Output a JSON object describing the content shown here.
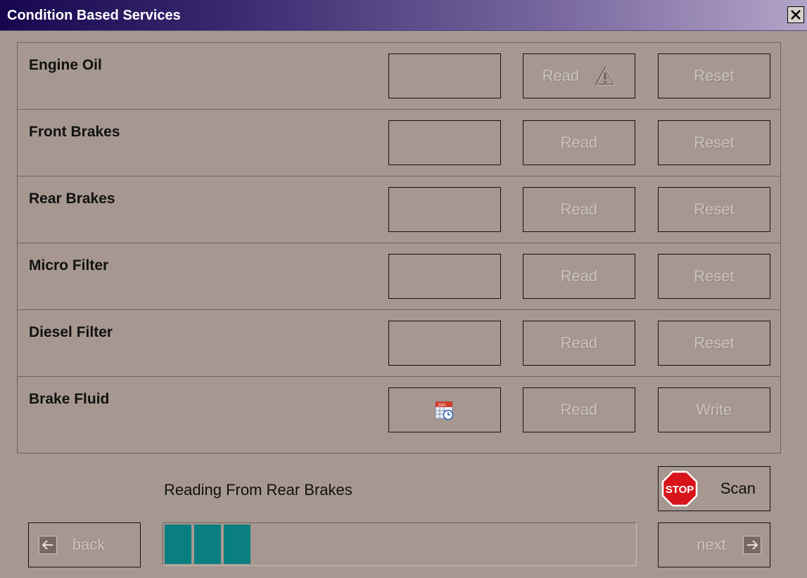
{
  "window": {
    "title": "Condition Based Services",
    "close_glyph": "✕"
  },
  "rows": [
    {
      "label": "Engine Oil",
      "value": "",
      "read": "Read",
      "action": "Reset",
      "read_icon": "warning-icon"
    },
    {
      "label": "Front Brakes",
      "value": "",
      "read": "Read",
      "action": "Reset"
    },
    {
      "label": "Rear Brakes",
      "value": "",
      "read": "Read",
      "action": "Reset"
    },
    {
      "label": "Micro Filter",
      "value": "",
      "read": "Read",
      "action": "Reset"
    },
    {
      "label": "Diesel Filter",
      "value": "",
      "read": "Read",
      "action": "Reset"
    },
    {
      "label": "Brake Fluid",
      "value_icon": "calendar-icon",
      "calendar_text": "JAN",
      "read": "Read",
      "action": "Write"
    }
  ],
  "status": {
    "text": "Reading From Rear Brakes"
  },
  "scan_button": {
    "stop_text": "STOP",
    "label": "Scan"
  },
  "nav": {
    "back": "back",
    "next": "next"
  },
  "progress": {
    "filled_segments": 3
  },
  "colors": {
    "progress_fill": "#0a7f80",
    "stop_red": "#d7141a",
    "disabled_text": "#cbc3bc"
  }
}
